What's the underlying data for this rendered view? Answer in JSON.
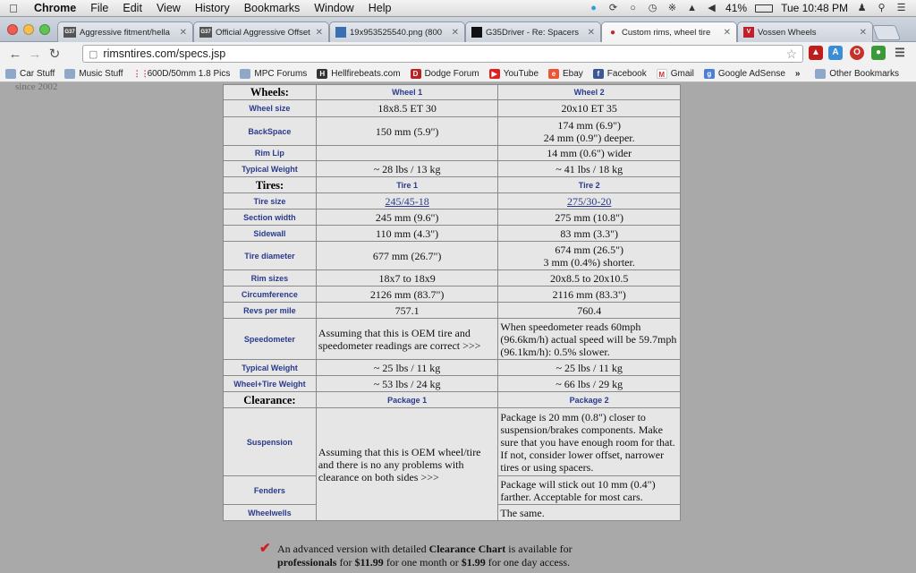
{
  "menubar": {
    "app": "Chrome",
    "items": [
      "File",
      "Edit",
      "View",
      "History",
      "Bookmarks",
      "Window",
      "Help"
    ],
    "battery": "41%",
    "clock": "Tue 10:48 PM"
  },
  "tabs": [
    {
      "favicon": "G37",
      "title": "Aggressive fitment/hella"
    },
    {
      "favicon": "G37",
      "title": "Official Aggressive Offset"
    },
    {
      "favicon": "img",
      "title": "19x953525540.png (800"
    },
    {
      "favicon": "G35",
      "title": "G35Driver - Re: Spacers"
    },
    {
      "favicon": "car",
      "title": "Custom rims, wheel tire"
    },
    {
      "favicon": "V",
      "title": "Vossen Wheels"
    }
  ],
  "address": {
    "url": "rimsntires.com/specs.jsp"
  },
  "bookmarks": [
    {
      "icon": "folder",
      "label": "Car Stuff"
    },
    {
      "icon": "folder",
      "label": "Music Stuff"
    },
    {
      "icon": "dots",
      "label": "600D/50mm 1.8 Pics"
    },
    {
      "icon": "folder",
      "label": "MPC Forums"
    },
    {
      "icon": "hf",
      "label": "Hellfirebeats.com"
    },
    {
      "icon": "dodge",
      "label": "Dodge Forum"
    },
    {
      "icon": "youtube",
      "label": "YouTube"
    },
    {
      "icon": "ebay",
      "label": "Ebay"
    },
    {
      "icon": "facebook",
      "label": "Facebook"
    },
    {
      "icon": "gmail",
      "label": "Gmail"
    },
    {
      "icon": "google",
      "label": "Google AdSense"
    },
    {
      "icon": "more",
      "label": "»"
    }
  ],
  "other_bookmarks": "Other Bookmarks",
  "page": {
    "since": "since 2002",
    "wheels": {
      "section": "Wheels:",
      "h1": "Wheel 1",
      "h2": "Wheel 2",
      "rows": [
        {
          "label": "Wheel size",
          "v1": "18x8.5 ET 30",
          "v2": "20x10 ET 35"
        },
        {
          "label": "BackSpace",
          "v1": "150 mm (5.9\")",
          "v2a": "174 mm (6.9\")",
          "v2b": "24 mm (0.9\") deeper."
        },
        {
          "label": "Rim Lip",
          "v1": "",
          "v2": "14 mm (0.6\") wider"
        },
        {
          "label": "Typical Weight",
          "v1": "~ 28 lbs / 13 kg",
          "v2": "~ 41 lbs / 18 kg"
        }
      ]
    },
    "tires": {
      "section": "Tires:",
      "h1": "Tire 1",
      "h2": "Tire 2",
      "size": {
        "label": "Tire size",
        "v1": "245/45-18",
        "v2": "275/30-20"
      },
      "section_width": {
        "label": "Section width",
        "v1": "245 mm (9.6\")",
        "v2": "275 mm (10.8\")"
      },
      "sidewall": {
        "label": "Sidewall",
        "v1": "110 mm (4.3\")",
        "v2": "83 mm (3.3\")"
      },
      "diameter": {
        "label": "Tire diameter",
        "v1": "677 mm (26.7\")",
        "v2a": "674 mm (26.5\")",
        "v2b": "3 mm (0.4%) shorter."
      },
      "rim_sizes": {
        "label": "Rim sizes",
        "v1": "18x7 to 18x9",
        "v2": "20x8.5 to 20x10.5"
      },
      "circumference": {
        "label": "Circumference",
        "v1": "2126 mm (83.7\")",
        "v2": "2116 mm (83.3\")"
      },
      "revs": {
        "label": "Revs per mile",
        "v1": "757.1",
        "v2": "760.4"
      },
      "speedometer": {
        "label": "Speedometer",
        "v1": "Assuming that this is OEM tire and speedometer readings are correct >>>",
        "v2": "When speedometer reads 60mph (96.6km/h) actual speed will be 59.7mph (96.1km/h): 0.5% slower."
      },
      "weight": {
        "label": "Typical Weight",
        "v1": "~ 25 lbs / 11 kg",
        "v2": "~ 25 lbs / 11 kg"
      },
      "wheel_tire_weight": {
        "label": "Wheel+Tire Weight",
        "v1": "~ 53 lbs / 24 kg",
        "v2": "~ 66 lbs / 29 kg"
      }
    },
    "clearance": {
      "section": "Clearance:",
      "h1": "Package 1",
      "h2": "Package 2",
      "p1_text": "Assuming that this is OEM wheel/tire and there is no any problems with clearance on both sides >>>",
      "suspension": {
        "label": "Suspension",
        "v2": "Package is 20 mm (0.8\") closer to suspension/brakes components. Make sure that you have enough room for that. If not, consider lower offset, narrower tires or using spacers."
      },
      "fenders": {
        "label": "Fenders",
        "v2": "Package will stick out 10 mm (0.4\") farther. Acceptable for most cars."
      },
      "wheelwells": {
        "label": "Wheelwells",
        "v2": "The same."
      }
    },
    "note": {
      "t1": "An advanced version with detailed ",
      "b1": "Clearance Chart",
      "t2": " is available for",
      "b2": "professionals",
      "t3": " for ",
      "b3": "$11.99",
      "t4": " for one month or ",
      "b4": "$1.99",
      "t5": " for one day access."
    }
  }
}
